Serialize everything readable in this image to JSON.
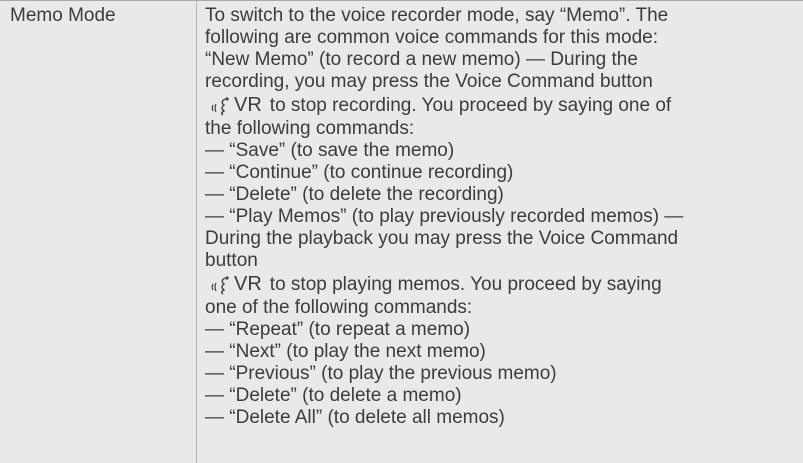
{
  "term": "Memo Mode",
  "lines": [
    "To switch to the voice recorder mode, say “Memo”. The",
    "following are common voice commands for this mode:",
    "“New Memo” (to record a new memo) — During the",
    "recording, you may press the Voice Command button"
  ],
  "vr_label": "VR",
  "vr_icon": "voice-command-icon",
  "vr_line_1": "to stop recording. You proceed by saying one of",
  "lines_2": [
    "the following commands:",
    "— “Save” (to save the memo)",
    "— “Continue” (to continue recording)",
    "— “Delete” (to delete the recording)",
    "— “Play Memos” (to play previously recorded memos) —",
    "During the playback you may press the Voice Command",
    "button"
  ],
  "vr_line_2": "to stop playing memos. You proceed by saying",
  "lines_3": [
    "one of the following commands:",
    "— “Repeat” (to repeat a memo)",
    "— “Next” (to play the next memo)",
    "— “Previous” (to play the previous memo)",
    "— “Delete” (to delete a memo)",
    "— “Delete All” (to delete all memos)"
  ],
  "colors": {
    "background": "#e8e9ea",
    "text": "#3c3c3c",
    "rule": "#a9a9a9"
  }
}
